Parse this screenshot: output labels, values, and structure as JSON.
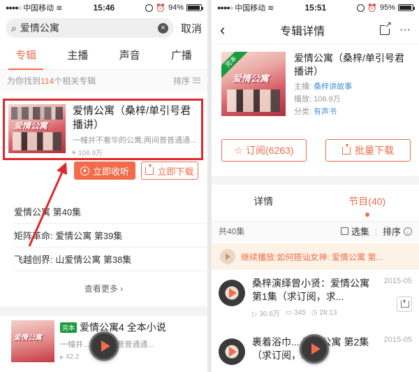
{
  "left": {
    "status": {
      "carrier": "中国移动",
      "time": "15:46",
      "battery": "94%",
      "battery_level": 0.94
    },
    "search": {
      "query": "爱情公寓",
      "cancel": "取消"
    },
    "tabs": [
      "专辑",
      "主播",
      "声音",
      "广播"
    ],
    "result_summary": {
      "prefix": "为你找到",
      "count": "114",
      "suffix": "个相关专辑",
      "sort": "排序"
    },
    "album": {
      "cover_logo": "爱情公寓",
      "title": "爱情公寓（桑梓/单引号君播讲）",
      "desc": "一幢并不奢华的公寓,两间普普通通...",
      "plays": "106.9万",
      "listen_button": "立即收听",
      "download_button": "立即下载"
    },
    "episodes": [
      "爱情公寓 第40集",
      "矩阵革命:  爱情公寓 第39集",
      "飞越创界:  山爱情公寓 第38集"
    ],
    "more": "查看更多",
    "album2": {
      "badge": "完本",
      "cover_logo": "爱情公寓",
      "title": "爱情公寓4 全本小说",
      "desc": "一幢并...:家,两间普普通通...",
      "plays": "42.2"
    }
  },
  "right": {
    "status": {
      "carrier": "中国移动",
      "time": "15:51",
      "battery": "95%",
      "battery_level": 0.95
    },
    "nav": {
      "back": "‹",
      "title": "专辑详情"
    },
    "album": {
      "badge": "完本",
      "cover_logo": "爱情公寓",
      "title": "爱情公寓（桑梓/单引号君播讲）",
      "host_label": "主播:",
      "host": "桑梓讲故事",
      "plays_label": "播放:",
      "plays": "106.9万",
      "category_label": "分类:",
      "category": "有声书",
      "subscribe": "订阅(6263)",
      "batch_download": "批量下载"
    },
    "tabs": [
      "详情",
      "节目(40)"
    ],
    "ep_bar": {
      "total": "共40集",
      "select": "选集",
      "sort": "排序"
    },
    "continue": "继续播放:如何搭讪女神: 爱情公寓 第...",
    "tracks": [
      {
        "title": "桑梓演绎曾小贤：爱情公寓 第1集（求订阅，求...",
        "date": "2015-05",
        "plays": "30.6万",
        "comments": "345",
        "duration": "28:13"
      },
      {
        "title": "裹着浴巾... 爱情公寓 第2集（求订阅，求...",
        "date": "2015-05"
      }
    ]
  }
}
